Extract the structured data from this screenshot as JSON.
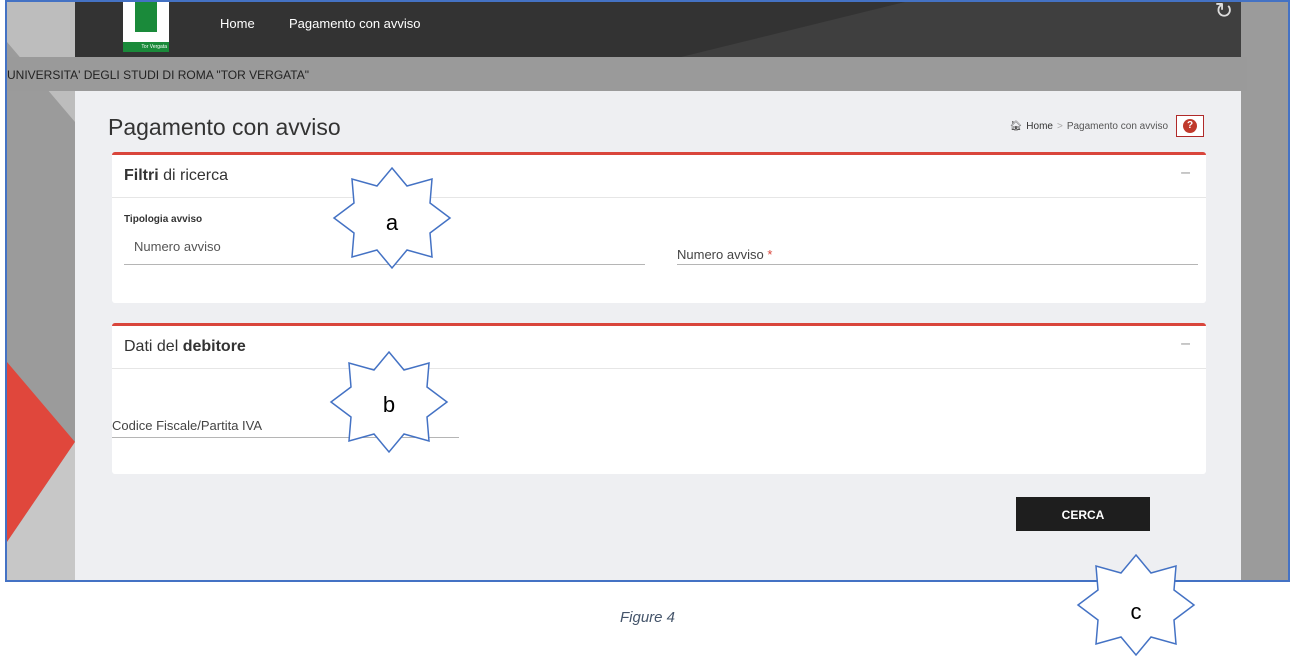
{
  "nav": {
    "home": "Home",
    "pagamento": "Pagamento con avviso"
  },
  "logo_text": "Tor Vergata",
  "university": "UNIVERSITA' DEGLI STUDI DI ROMA \"TOR VERGATA\"",
  "page_title": "Pagamento con avviso",
  "breadcrumb": {
    "home": "Home",
    "separator": ">",
    "current": "Pagamento con avviso"
  },
  "filters": {
    "title_bold": "Filtri",
    "title_rest": " di ricerca",
    "collapse": "–",
    "tipologia_label": "Tipologia avviso",
    "tipologia_value": "Numero avviso",
    "numero_label": "Numero avviso",
    "required_mark": "*"
  },
  "debtor": {
    "title_rest": "Dati del ",
    "title_bold": "debitore",
    "collapse": "–",
    "cf_label": "Codice Fiscale/Partita IVA"
  },
  "search_button": "CERCA",
  "annotations": {
    "a": "a",
    "b": "b",
    "c": "c"
  },
  "caption": "Figure 4",
  "colors": {
    "accent": "#d9453b",
    "topbar": "#333333",
    "button": "#1e1e1e",
    "frame": "#4472c4"
  }
}
